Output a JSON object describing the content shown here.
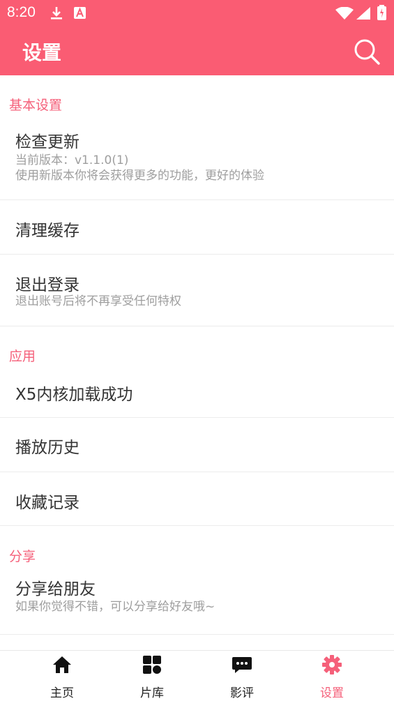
{
  "status_bar": {
    "time": "8:20"
  },
  "header": {
    "title": "设置"
  },
  "sections": [
    {
      "title": "基本设置",
      "items": [
        {
          "title": "检查更新",
          "subtitle_1": "当前版本：v1.1.0(1)",
          "subtitle_2": "使用新版本你将会获得更多的功能，更好的体验"
        },
        {
          "title": "清理缓存"
        },
        {
          "title": "退出登录",
          "subtitle_1": "退出账号后将不再享受任何特权"
        }
      ]
    },
    {
      "title": "应用",
      "items": [
        {
          "title": "X5内核加载成功"
        },
        {
          "title": "播放历史"
        },
        {
          "title": "收藏记录"
        }
      ]
    },
    {
      "title": "分享",
      "items": [
        {
          "title": "分享给朋友",
          "subtitle_1": "如果你觉得不错，可以分享给好友哦~"
        }
      ]
    }
  ],
  "bottom_nav": [
    {
      "label": "主页",
      "icon": "home-icon"
    },
    {
      "label": "片库",
      "icon": "grid-icon"
    },
    {
      "label": "影评",
      "icon": "comment-icon"
    },
    {
      "label": "设置",
      "icon": "gear-icon",
      "active": true
    }
  ],
  "colors": {
    "accent": "#fa5c73",
    "section_title": "#f5607a"
  }
}
